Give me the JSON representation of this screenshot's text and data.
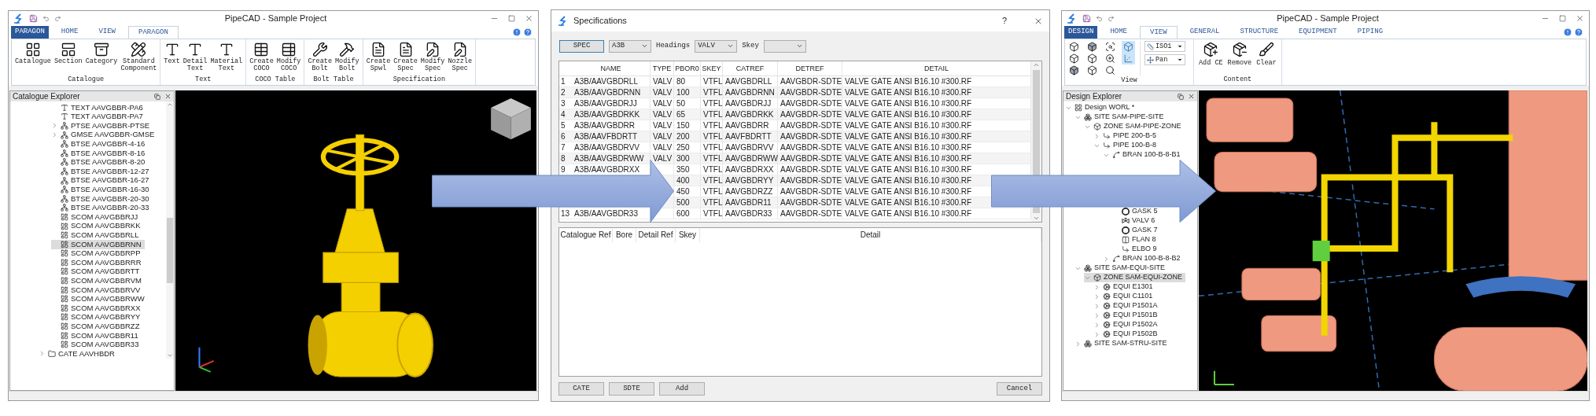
{
  "catalogue_window": {
    "title": "PipeCAD - Sample Project",
    "app_tab": "PARAGON",
    "tabs": [
      {
        "label": "HOME",
        "selected": false
      },
      {
        "label": "VIEW",
        "selected": false
      },
      {
        "label": "PARAGON",
        "selected": true
      }
    ],
    "ribbon_groups": [
      {
        "label": "Catalogue",
        "buttons": [
          {
            "label": "Catalogue",
            "kind": "grid"
          },
          {
            "label": "Section",
            "kind": "section"
          },
          {
            "label": "Category",
            "kind": "category"
          },
          {
            "label": "Standard Component",
            "kind": "ruler"
          }
        ]
      },
      {
        "label": "Text",
        "buttons": [
          {
            "label": "Text",
            "kind": "text"
          },
          {
            "label": "Detail Text",
            "kind": "text"
          },
          {
            "label": "Material Text",
            "kind": "text"
          }
        ]
      },
      {
        "label": "COCO Table",
        "buttons": [
          {
            "label": "Create COCO",
            "kind": "table"
          },
          {
            "label": "Modify COCO",
            "kind": "table_edit"
          }
        ]
      },
      {
        "label": "Bolt Table",
        "buttons": [
          {
            "label": "Create Bolt",
            "kind": "bolt"
          },
          {
            "label": "Modify Bolt",
            "kind": "bolt_edit"
          }
        ]
      },
      {
        "label": "Specification",
        "buttons": [
          {
            "label": "Create Spwl",
            "kind": "doc"
          },
          {
            "label": "Create Spec",
            "kind": "doc"
          },
          {
            "label": "Modify Spec",
            "kind": "doc_edit"
          },
          {
            "label": "Nozzle Spec",
            "kind": "doc_edit"
          }
        ]
      }
    ],
    "explorer": {
      "title": "Catalogue Explorer",
      "tree": [
        {
          "children": [
            {
              "label": "TEXT AAVGBBR-PA6",
              "kind": "text",
              "selected": false
            },
            {
              "label": "TEXT AAVGBBR-PA7",
              "kind": "text",
              "selected": false
            },
            {
              "label": "PTSE AAVGBBR-PTSE",
              "kind": "structure",
              "expanded": false,
              "selected": false
            },
            {
              "label": "GMSE AAVGBBR-GMSE",
              "kind": "structure",
              "expanded": false,
              "selected": false
            },
            {
              "label": "BTSE AAVGBBR-4-16",
              "kind": "structure",
              "selected": false
            },
            {
              "label": "BTSE AAVGBBR-8-16",
              "kind": "structure",
              "selected": false
            },
            {
              "label": "BTSE AAVGBBR-8-20",
              "kind": "structure",
              "selected": false
            },
            {
              "label": "BTSE AAVGBBR-12-27",
              "kind": "structure",
              "selected": false
            },
            {
              "label": "BTSE AAVGBBR-16-27",
              "kind": "structure",
              "selected": false
            },
            {
              "label": "BTSE AAVGBBR-16-30",
              "kind": "structure",
              "selected": false
            },
            {
              "label": "BTSE AAVGBBR-20-30",
              "kind": "structure",
              "selected": false
            },
            {
              "label": "BTSE AAVGBBR-20-33",
              "kind": "structure",
              "selected": false
            },
            {
              "label": "SCOM AAVGBBRJJ",
              "kind": "component",
              "selected": false
            },
            {
              "label": "SCOM AAVGBBRKK",
              "kind": "component",
              "selected": false
            },
            {
              "label": "SCOM AAVGBBRLL",
              "kind": "component",
              "selected": false
            },
            {
              "label": "SCOM AAVGBBRNN",
              "kind": "component",
              "selected": true
            },
            {
              "label": "SCOM AAVGBBRPP",
              "kind": "component",
              "selected": false
            },
            {
              "label": "SCOM AAVGBBRRR",
              "kind": "component",
              "selected": false
            },
            {
              "label": "SCOM AAVGBBRTT",
              "kind": "component",
              "selected": false
            },
            {
              "label": "SCOM AAVGBBRVM",
              "kind": "component",
              "selected": false
            },
            {
              "label": "SCOM AAVGBBRVV",
              "kind": "component",
              "selected": false
            },
            {
              "label": "SCOM AAVGBBRWW",
              "kind": "component",
              "selected": false
            },
            {
              "label": "SCOM AAVGBBRXX",
              "kind": "component",
              "selected": false
            },
            {
              "label": "SCOM AAVGBBRYY",
              "kind": "component",
              "selected": false
            },
            {
              "label": "SCOM AAVGBBRZZ",
              "kind": "component",
              "selected": false
            },
            {
              "label": "SCOM AAVGBBR11",
              "kind": "component",
              "selected": false
            },
            {
              "label": "SCOM AAVGBBR33",
              "kind": "component",
              "selected": false
            }
          ]
        },
        {
          "label": "CATE AAVHBDR",
          "kind": "folder",
          "expanded": false,
          "selected": false
        }
      ]
    }
  },
  "specifications_dialog": {
    "title": "Specifications",
    "help": "?",
    "spec_button": "SPEC",
    "spec_select": "A3B",
    "headings_label": "Headings",
    "headings_select": "VALV",
    "skey_label": "Skey",
    "columns": [
      "NAME",
      "TYPE",
      "PBOR0",
      "SKEY",
      "CATREF",
      "DETREF",
      "DETAIL"
    ],
    "rows": [
      {
        "number": "1",
        "name": "A3B/AAVGBDRLL",
        "type": "VALV",
        "pbor0": "80",
        "skey": "VTFL",
        "catref": "AAVGBDRLL",
        "detref": "AAVGBDR-SDTE",
        "detail": "VALVE GATE ANSI B16.10 #300.RF"
      },
      {
        "number": "2",
        "name": "A3B/AAVGBDRNN",
        "type": "VALV",
        "pbor0": "100",
        "skey": "VTFL",
        "catref": "AAVGBDRNN",
        "detref": "AAVGBDR-SDTE",
        "detail": "VALVE GATE ANSI B16.10 #300.RF"
      },
      {
        "number": "3",
        "name": "A3B/AAVGBDRJJ",
        "type": "VALV",
        "pbor0": "50",
        "skey": "VTFL",
        "catref": "AAVGBDRJJ",
        "detref": "AAVGBDR-SDTE",
        "detail": "VALVE GATE ANSI B16.10 #300.RF"
      },
      {
        "number": "4",
        "name": "A3B/AAVGBDRKK",
        "type": "VALV",
        "pbor0": "65",
        "skey": "VTFL",
        "catref": "AAVGBDRKK",
        "detref": "AAVGBDR-SDTE",
        "detail": "VALVE GATE ANSI B16.10 #300.RF"
      },
      {
        "number": "5",
        "name": "A3B/AAVGBDRR",
        "type": "VALV",
        "pbor0": "150",
        "skey": "VTFL",
        "catref": "AAVGBDRR",
        "detref": "AAVGBDR-SDTE",
        "detail": "VALVE GATE ANSI B16.10 #300.RF"
      },
      {
        "number": "6",
        "name": "A3B/AAVFBDRTT",
        "type": "VALV",
        "pbor0": "200",
        "skey": "VTFL",
        "catref": "AAVFBDRTT",
        "detref": "AAVGBDR-SDTE",
        "detail": "VALVE GATE ANSI B16.10 #300.RF"
      },
      {
        "number": "7",
        "name": "A3B/AAVGBDRVV",
        "type": "VALV",
        "pbor0": "250",
        "skey": "VTFL",
        "catref": "AAVGBDRVV",
        "detref": "AAVGBDR-SDTE",
        "detail": "VALVE GATE ANSI B16.10 #300.RF"
      },
      {
        "number": "8",
        "name": "A3B/AAVGBDRWW",
        "type": "VALV",
        "pbor0": "300",
        "skey": "VTFL",
        "catref": "AAVGBDRWW",
        "detref": "AAVGBDR-SDTE",
        "detail": "VALVE GATE ANSI B16.10 #300.RF"
      },
      {
        "number": "9",
        "name": "A3B/AAVGBDRXX",
        "pbor0": "350",
        "skey": "VTFL",
        "catref": "AAVGBDRXX",
        "detref": "AAVGBDR-SDTE",
        "detail": "VALVE GATE ANSI B16.10 #300.RF"
      },
      {
        "pbor0": "400",
        "skey": "VTFL",
        "catref": "AAVGBDRYY",
        "detref": "AAVGBDR-SDTE",
        "detail": "VALVE GATE ANSI B16.10 #300.RF"
      },
      {
        "pbor0": "450",
        "skey": "VTFL",
        "catref": "AAVGBDRZZ",
        "detref": "AAVGBDR-SDTE",
        "detail": "VALVE GATE ANSI B16.10 #300.RF"
      },
      {
        "pbor0": "500",
        "skey": "VTFL",
        "catref": "AAVGBDR11",
        "detref": "AAVGBDR-SDTE",
        "detail": "VALVE GATE ANSI B16.10 #300.RF"
      },
      {
        "number": "13",
        "name": "A3B/AAVGBDR33",
        "pbor0": "600",
        "skey": "VTFL",
        "catref": "AAVGBDR33",
        "detref": "AAVGBDR-SDTE",
        "detail": "VALVE GATE ANSI B16.10 #300.RF"
      }
    ],
    "detail_columns": [
      "Catalogue Ref",
      "Bore",
      "Detail Ref",
      "Skey",
      "Detail"
    ],
    "buttons": [
      "CATE",
      "SDTE",
      "Add"
    ],
    "cancel_button": "Cancel"
  },
  "design_window": {
    "title": "PipeCAD - Sample Project",
    "app_tab": "DESIGN",
    "tabs": [
      {
        "label": "HOME",
        "selected": false
      },
      {
        "label": "VIEW",
        "selected": true
      },
      {
        "label": "GENERAL",
        "selected": false
      },
      {
        "label": "STRUCTURE",
        "selected": false
      },
      {
        "label": "EQUIPMENT",
        "selected": false
      },
      {
        "label": "PIPING",
        "selected": false
      }
    ],
    "ribbon": {
      "view_group": "View",
      "view_tools": [
        {
          "kind": "cube",
          "on": false
        },
        {
          "kind": "cube",
          "on": false
        },
        {
          "kind": "cube_solid",
          "on": false
        },
        {
          "kind": "cube_solid",
          "on": false
        },
        {
          "kind": "cube",
          "on": false
        },
        {
          "kind": "cube",
          "on": false
        },
        {
          "kind": "zoom_box",
          "on": false
        },
        {
          "kind": "zoom",
          "on": false
        },
        {
          "kind": "zoom_all",
          "on": false
        },
        {
          "kind": "cube",
          "on": true
        },
        {
          "kind": "axes",
          "on": true
        }
      ],
      "dropdowns": [
        {
          "value": "ISO1",
          "kind": "view"
        },
        {
          "value": "Pan",
          "kind": "pan"
        }
      ],
      "content_group": "Content",
      "content_buttons": [
        {
          "label": "Add CE",
          "kind": "add"
        },
        {
          "label": "Remove",
          "kind": "remove"
        },
        {
          "label": "Clear",
          "kind": "clear"
        }
      ]
    },
    "explorer": {
      "title": "Design Explorer",
      "tree": [
        {
          "label": "Design WORL *",
          "kind": "world",
          "expanded": true,
          "selected": false,
          "children": [
            {
              "label": "SITE SAM-PIPE-SITE",
              "kind": "site",
              "expanded": true,
              "selected": false,
              "children": [
                {
                  "label": "ZONE SAM-PIPE-ZONE",
                  "kind": "zone",
                  "expanded": true,
                  "selected": false,
                  "children": [
                    {
                      "label": "PIPE 200-B-5",
                      "kind": "pipe",
                      "expanded": false,
                      "selected": false
                    },
                    {
                      "label": "PIPE 100-B-8",
                      "kind": "pipe",
                      "expanded": true,
                      "selected": false,
                      "children": [
                        {
                          "label": "BRAN 100-B-8-B1",
                          "kind": "branch",
                          "expanded": true,
                          "selected": false,
                          "children": [
                            {
                              "label": "GASK 5",
                              "kind": "gasket",
                              "selected": false
                            },
                            {
                              "label": "VALV 6",
                              "kind": "valve",
                              "selected": false
                            },
                            {
                              "label": "GASK 7",
                              "kind": "gasket",
                              "selected": false
                            },
                            {
                              "label": "FLAN 8",
                              "kind": "flange",
                              "selected": false
                            },
                            {
                              "label": "ELBO 9",
                              "kind": "elbow",
                              "selected": false
                            }
                          ]
                        },
                        {
                          "label": "BRAN 100-B-8-B2",
                          "kind": "branch",
                          "expanded": false,
                          "selected": false
                        }
                      ]
                    }
                  ]
                }
              ]
            },
            {
              "label": "SITE SAM-EQUI-SITE",
              "kind": "site",
              "expanded": true,
              "selected": false,
              "children": [
                {
                  "label": "ZONE SAM-EQUI-ZONE",
                  "kind": "zone",
                  "expanded": true,
                  "selected": true,
                  "children": [
                    {
                      "label": "EQUI E1301",
                      "kind": "equipment",
                      "expanded": false,
                      "selected": false
                    },
                    {
                      "label": "EQUI C1101",
                      "kind": "equipment",
                      "expanded": false,
                      "selected": false
                    },
                    {
                      "label": "EQUI P1501A",
                      "kind": "equipment",
                      "expanded": false,
                      "selected": false
                    },
                    {
                      "label": "EQUI P1501B",
                      "kind": "equipment",
                      "expanded": false,
                      "selected": false
                    },
                    {
                      "label": "EQUI P1502A",
                      "kind": "equipment",
                      "expanded": false,
                      "selected": false
                    },
                    {
                      "label": "EQUI P1502B",
                      "kind": "equipment",
                      "expanded": false,
                      "selected": false
                    }
                  ]
                }
              ]
            },
            {
              "label": "SITE SAM-STRU-SITE",
              "kind": "site",
              "expanded": false,
              "selected": false
            }
          ]
        }
      ]
    }
  }
}
